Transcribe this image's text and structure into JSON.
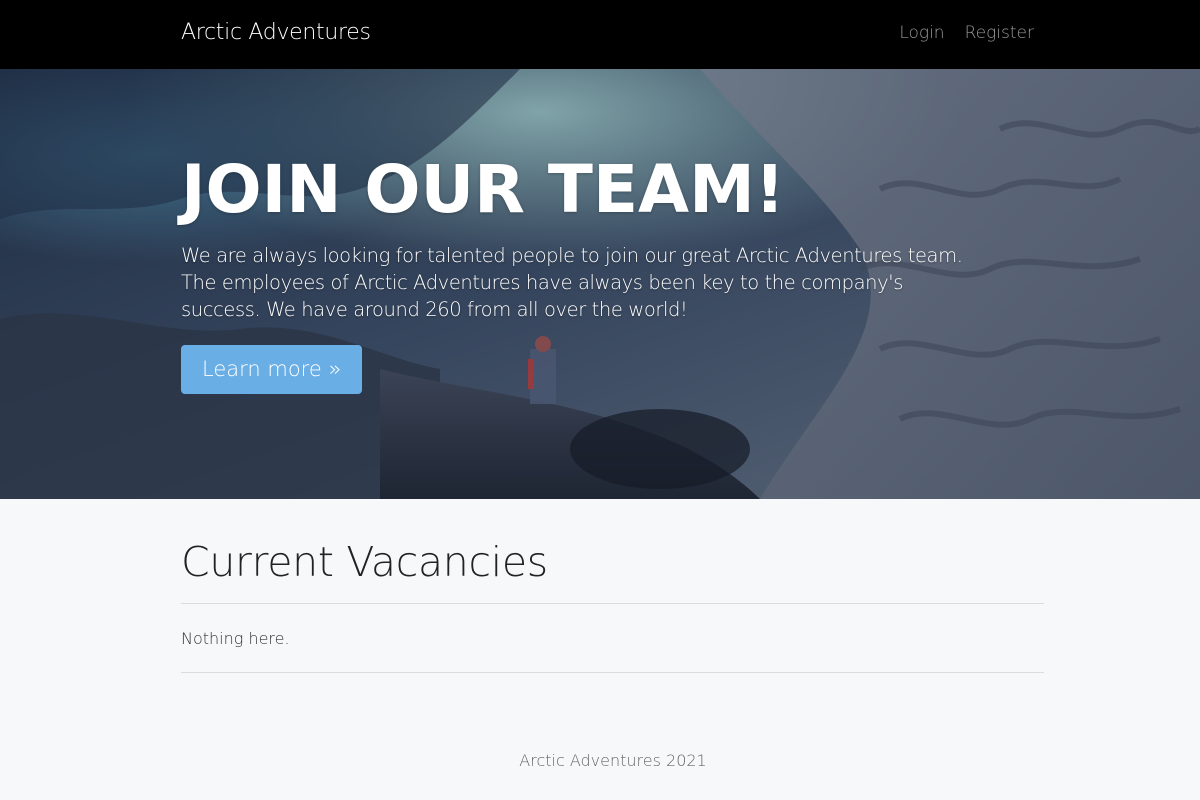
{
  "navbar": {
    "brand": "Arctic Adventures",
    "links": [
      {
        "label": "Login"
      },
      {
        "label": "Register"
      }
    ]
  },
  "hero": {
    "title": "JOIN OUR TEAM!",
    "line1": "We are always looking for talented people to join our great Arctic Adventures team.",
    "line2": "The employees of Arctic Adventures have always been key to the company's",
    "line3": "success. We have around 260 from all over the world!",
    "button_label": "Learn more »"
  },
  "vacancies": {
    "title": "Current Vacancies",
    "empty_text": "Nothing here."
  },
  "footer": {
    "text": "Arctic Adventures 2021"
  },
  "colors": {
    "navbar_bg": "#000000",
    "button_bg": "#6aaee6",
    "page_bg": "#f7f8fa"
  }
}
